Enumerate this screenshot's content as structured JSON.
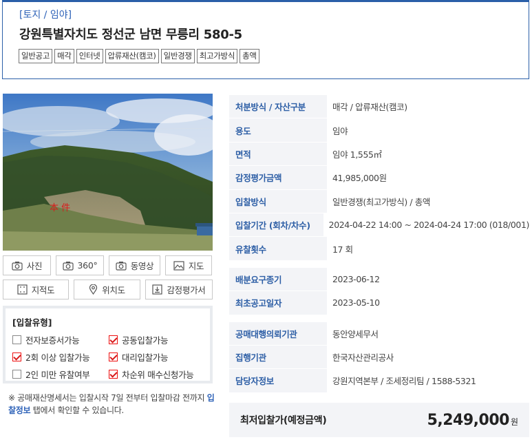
{
  "header": {
    "category": "[토지 / 임야]",
    "title": "강원특별자치도 정선군 남면 무릉리 580-5",
    "tags": [
      "일반공고",
      "매각",
      "인터넷",
      "압류재산(캠코)",
      "일반경쟁",
      "최고가방식",
      "총액"
    ]
  },
  "photo": {
    "overlay_text": "本 件"
  },
  "media_buttons": {
    "photo": "사진",
    "view360": "360°",
    "video": "동영상",
    "map": "지도",
    "cadastral": "지적도",
    "location": "위치도",
    "appraisal": "감정평가서"
  },
  "bid_type": {
    "title": "[입찰유형]",
    "items": [
      {
        "label": "전자보증서가능",
        "checked": false
      },
      {
        "label": "공동입찰가능",
        "checked": true
      },
      {
        "label": "2회 이상 입찰가능",
        "checked": true
      },
      {
        "label": "대리입찰가능",
        "checked": true
      },
      {
        "label": "2인 미만 유찰여부",
        "checked": false
      },
      {
        "label": "차순위 매수신청가능",
        "checked": true
      }
    ]
  },
  "notice": {
    "prefix": "※ 공매재산명세서는 입찰시작 7일 전부터 입찰마감 전까지 ",
    "link": "입찰정보",
    "suffix": " 탭에서 확인할 수 있습니다."
  },
  "info": {
    "group1": [
      {
        "label": "처분방식 / 자산구분",
        "value": "매각 / 압류재산(캠코)"
      },
      {
        "label": "용도",
        "value": "임야"
      },
      {
        "label": "면적",
        "value": "임야 1,555㎡"
      },
      {
        "label": "감정평가금액",
        "value": "41,985,000원"
      },
      {
        "label": "입찰방식",
        "value": "일반경쟁(최고가방식) / 총액"
      },
      {
        "label": "입찰기간 (회차/차수)",
        "value": "2024-04-22 14:00 ~ 2024-04-24 17:00 (018/001)"
      },
      {
        "label": "유찰횟수",
        "value": "17 회"
      }
    ],
    "group2": [
      {
        "label": "배분요구종기",
        "value": "2023-06-12"
      },
      {
        "label": "최초공고일자",
        "value": "2023-05-10"
      }
    ],
    "group3": [
      {
        "label": "공매대행의뢰기관",
        "value": "동안양세무서"
      },
      {
        "label": "집행기관",
        "value": "한국자산관리공사"
      },
      {
        "label": "담당자정보",
        "value": "강원지역본부 / 조세정리팀 / 1588-5321"
      }
    ]
  },
  "price": {
    "label": "최저입찰가(예정금액)",
    "value": "5,249,000",
    "unit": "원"
  }
}
